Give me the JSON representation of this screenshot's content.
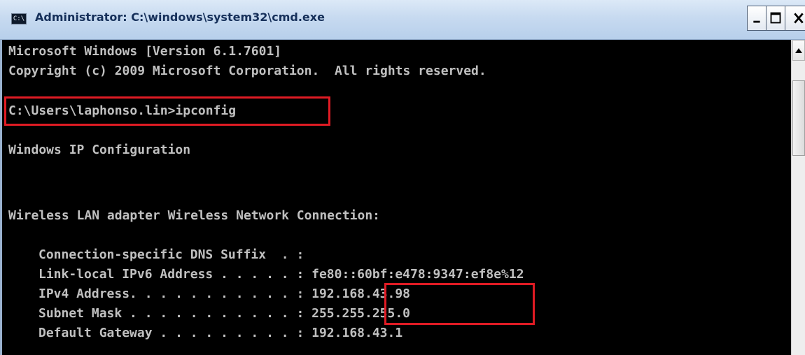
{
  "window": {
    "icon_text": "C:\\",
    "title": "Administrator: C:\\windows\\system32\\cmd.exe"
  },
  "console": {
    "lines": [
      "Microsoft Windows [Version 6.1.7601]",
      "Copyright (c) 2009 Microsoft Corporation.  All rights reserved.",
      "C:\\Users\\laphonso.lin>ipconfig",
      "Windows IP Configuration",
      "Wireless LAN adapter Wireless Network Connection:",
      "Connection-specific DNS Suffix  . :",
      "Link-local IPv6 Address . . . . . : fe80::60bf:e478:9347:ef8e%12",
      "IPv4 Address. . . . . . . . . . . : 192.168.43.98",
      "Subnet Mask . . . . . . . . . . . : 255.255.255.0",
      "Default Gateway . . . . . . . . . : 192.168.43.1"
    ]
  },
  "annotations": {
    "highlight_color": "#e01b24"
  },
  "icons": {
    "app": "cmd-icon",
    "minimize": "minimize-icon",
    "maximize": "maximize-icon",
    "close": "close-icon",
    "scroll_up": "scroll-up-arrow-icon"
  }
}
